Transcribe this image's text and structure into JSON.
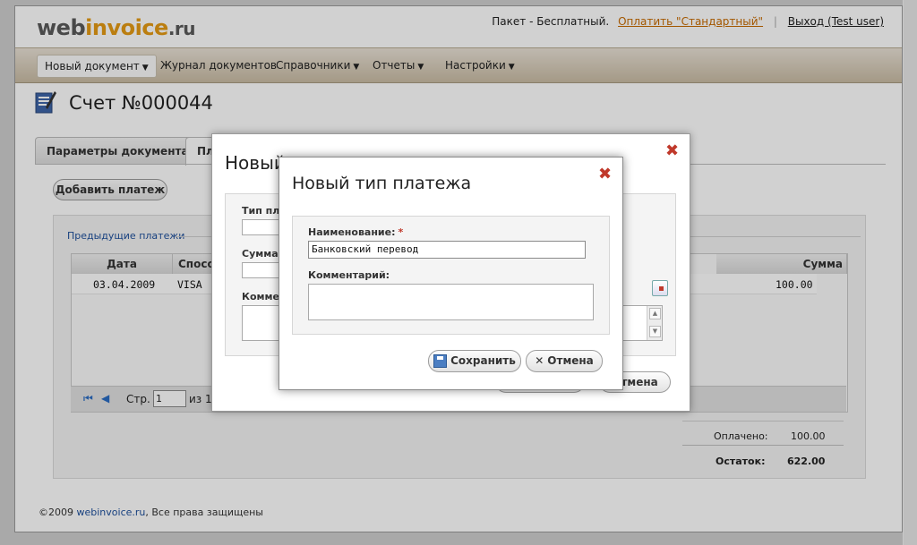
{
  "logo": {
    "part1": "web",
    "part2": "invoice",
    "part3": ".ru"
  },
  "topbar": {
    "plan": "Пакет - Бесплатный.",
    "pay_link": "Оплатить \"Стандартный\"",
    "separator": "|",
    "exit": "Выход (Test user)"
  },
  "menu": {
    "items": [
      "Новый документ",
      "Журнал документов",
      "Справочники",
      "Отчеты",
      "Настройки"
    ]
  },
  "page": {
    "title": "Счет №000044"
  },
  "tabs": [
    "Параметры документа",
    "Пл"
  ],
  "add_payment_button": "Добавить платеж",
  "previous_payments": {
    "label": "Предыдущие платежи",
    "columns": [
      "Дата",
      "Способ",
      "Сумма"
    ],
    "rows": [
      {
        "date": "03.04.2009",
        "method": "VISA",
        "amount": "100.00"
      }
    ]
  },
  "pager": {
    "first": "⏮",
    "prev": "◀",
    "page_label": "Стр.",
    "page_value": "1",
    "of": "из 1"
  },
  "totals": {
    "paid_label": "Оплачено:",
    "paid_value": "100.00",
    "rest_label": "Остаток:",
    "rest_value": "622.00"
  },
  "footer": {
    "copyright": "©2009 ",
    "site": "webinvoice.ru",
    "rights": ", Все права защищены"
  },
  "dialog_payment": {
    "title": "Новый",
    "close": "✖",
    "type_label": "Тип пла",
    "sum_label": "Сумма:",
    "comment_label": "Коммен",
    "cancel_tail": "Отмена"
  },
  "dialog_new_type": {
    "title": "Новый тип платежа",
    "close": "✖",
    "name_label": "Наименование:",
    "required_mark": "*",
    "name_value": "Банковский перевод",
    "comment_label": "Комментарий:",
    "comment_value": "",
    "save_button": "Сохранить",
    "cancel_button": "Отмена"
  },
  "colors": {
    "accent": "#e59a14",
    "link": "#1d4f9c",
    "close": "#c0392b"
  }
}
